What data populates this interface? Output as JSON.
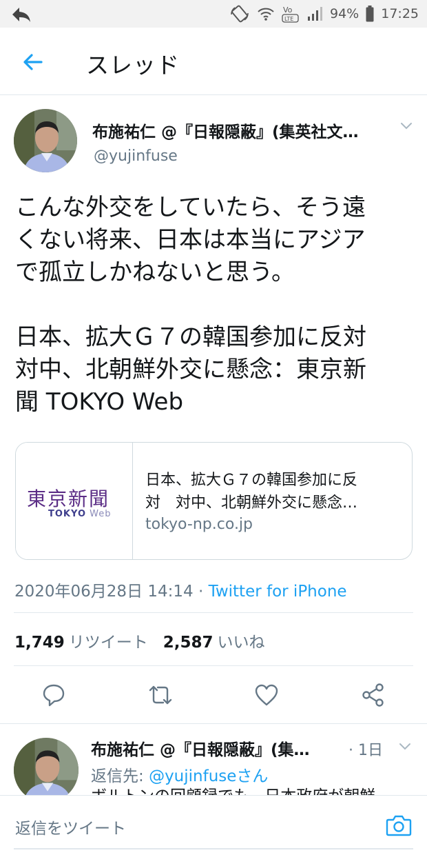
{
  "status_bar": {
    "battery": "94%",
    "time": "17:25",
    "icons": [
      "back-icon",
      "rotate-icon",
      "wifi-icon",
      "volte-icon",
      "signal-icon",
      "battery-icon"
    ]
  },
  "header": {
    "title": "スレッド",
    "back_icon": "arrow-left-icon"
  },
  "tweet": {
    "author_name": "布施祐仁 @『日報隠蔽』(集英社文…",
    "author_handle": "@yujinfuse",
    "text_lines_1": [
      "こんな外交をしていたら、そう遠",
      "くない将来、日本は本当にアジア",
      "で孤立しかねないと思う。"
    ],
    "text_lines_2": [
      "日本、拡大Ｇ７の韓国参加に反対",
      "対中、北朝鮮外交に懸念：東京新",
      "聞 TOKYO Web"
    ],
    "card": {
      "logo_jp": "東京新聞",
      "logo_en": "TOKYO",
      "logo_en_sub": "Web",
      "title_line1": "日本、拡大Ｇ７の韓国参加に反",
      "title_line2": "対　対中、北朝鮮外交に懸念…",
      "domain": "tokyo-np.co.jp"
    },
    "timestamp": "2020年06月28日 14:14 · ",
    "source": "Twitter for iPhone",
    "retweet_count": "1,749",
    "retweet_label": "リツイート",
    "like_count": "2,587",
    "like_label": "いいね"
  },
  "actions": [
    "reply-icon",
    "retweet-icon",
    "like-icon",
    "share-icon"
  ],
  "reply": {
    "author_name": "布施祐仁 @『日報隠蔽』(集…",
    "time": "· 1日",
    "reply_to_prefix": "返信先: ",
    "reply_to_mention": "@yujinfuseさん",
    "text": "ボルトンの回顧録でも、日本政府が朝鮮"
  },
  "compose": {
    "placeholder": "返信をツイート"
  },
  "colors": {
    "accent": "#1da1f2",
    "secondary_text": "#657786",
    "border": "#e1e8ed",
    "logo_purple": "#5b2d86"
  }
}
